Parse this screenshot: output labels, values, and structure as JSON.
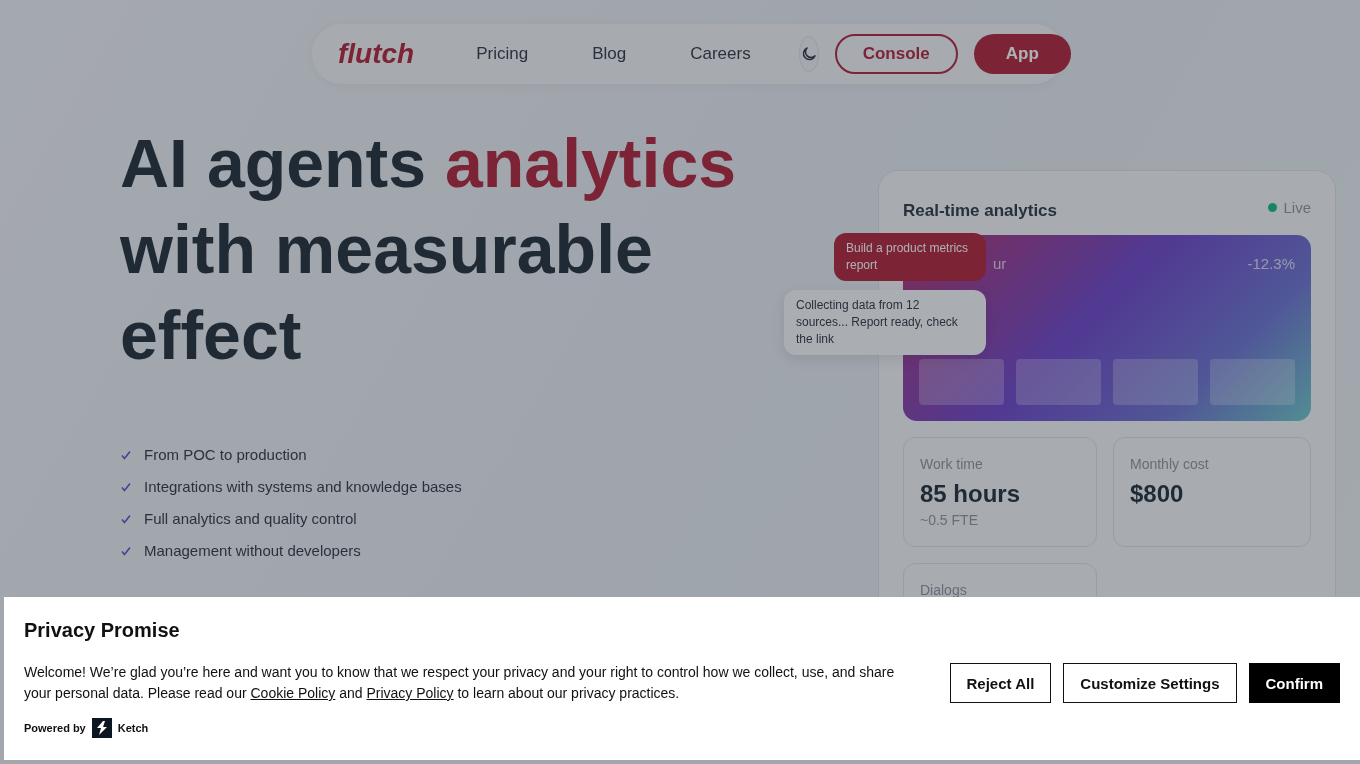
{
  "nav": {
    "logo": "flutch",
    "links": [
      "Pricing",
      "Blog",
      "Careers"
    ],
    "console": "Console",
    "app": "App"
  },
  "hero": {
    "headline": [
      {
        "text": "AI agents",
        "accent": false
      },
      {
        "text": "analytics",
        "accent": true
      },
      {
        "text": "with measurable effect",
        "accent": false
      }
    ],
    "features": [
      "From POC to production",
      "Integrations with systems and knowledge bases",
      "Full analytics and quality control",
      "Management without developers"
    ]
  },
  "analytics": {
    "title": "Real-time analytics",
    "live": "Live",
    "banner": {
      "label": "ur",
      "change": "-12.3%"
    },
    "stats": [
      {
        "label": "Work time",
        "value": "85 hours",
        "note": "~0.5 FTE"
      },
      {
        "label": "Monthly cost",
        "value": "$800"
      },
      {
        "label": "Dialogs"
      }
    ]
  },
  "chat": [
    {
      "kind": "request",
      "text": "Build a product metrics report"
    },
    {
      "kind": "reply",
      "text": "Collecting data from 12 sources... Report ready, check the link"
    }
  ],
  "cookie_banner": {
    "title": "Privacy Promise",
    "text": "Welcome! We’re glad you’re here and want you to know that we respect your privacy and your right to control how we collect, use, and share your personal data. Please read our",
    "cookie_link": "Cookie Policy",
    "and": "and",
    "privacy_link": "Privacy Policy",
    "tail": "to learn about our privacy practices.",
    "powered_by": "Powered by",
    "brand": "Ketch",
    "buttons": [
      {
        "label": "Reject All",
        "kind": "outline"
      },
      {
        "label": "Customize Settings",
        "kind": "outline"
      },
      {
        "label": "Confirm",
        "kind": "solid"
      }
    ]
  }
}
